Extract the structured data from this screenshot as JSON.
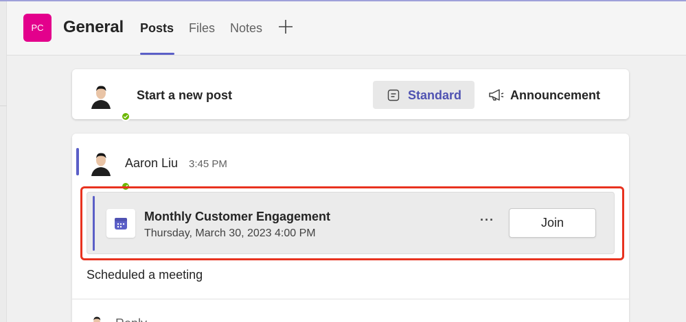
{
  "header": {
    "team_initials": "PC",
    "channel_name": "General",
    "tabs": [
      {
        "label": "Posts",
        "active": true
      },
      {
        "label": "Files",
        "active": false
      },
      {
        "label": "Notes",
        "active": false
      }
    ],
    "add_tab_icon": "plus-icon"
  },
  "composer": {
    "prompt": "Start a new post",
    "standard_label": "Standard",
    "announcement_label": "Announcement",
    "standard_icon": "compose-note-icon",
    "announcement_icon": "megaphone-icon"
  },
  "post": {
    "author": "Aaron Liu",
    "time": "3:45 PM",
    "meeting": {
      "title": "Monthly Customer Engagement",
      "datetime": "Thursday, March 30, 2023 4:00 PM",
      "more_label": "···",
      "join_label": "Join",
      "icon": "calendar-icon"
    },
    "body": "Scheduled a meeting",
    "reply_label": "Reply"
  },
  "colors": {
    "brand": "#5b5fc7",
    "team_avatar": "#e3008c",
    "presence_available": "#6bb700",
    "highlight": "#e8321f"
  }
}
